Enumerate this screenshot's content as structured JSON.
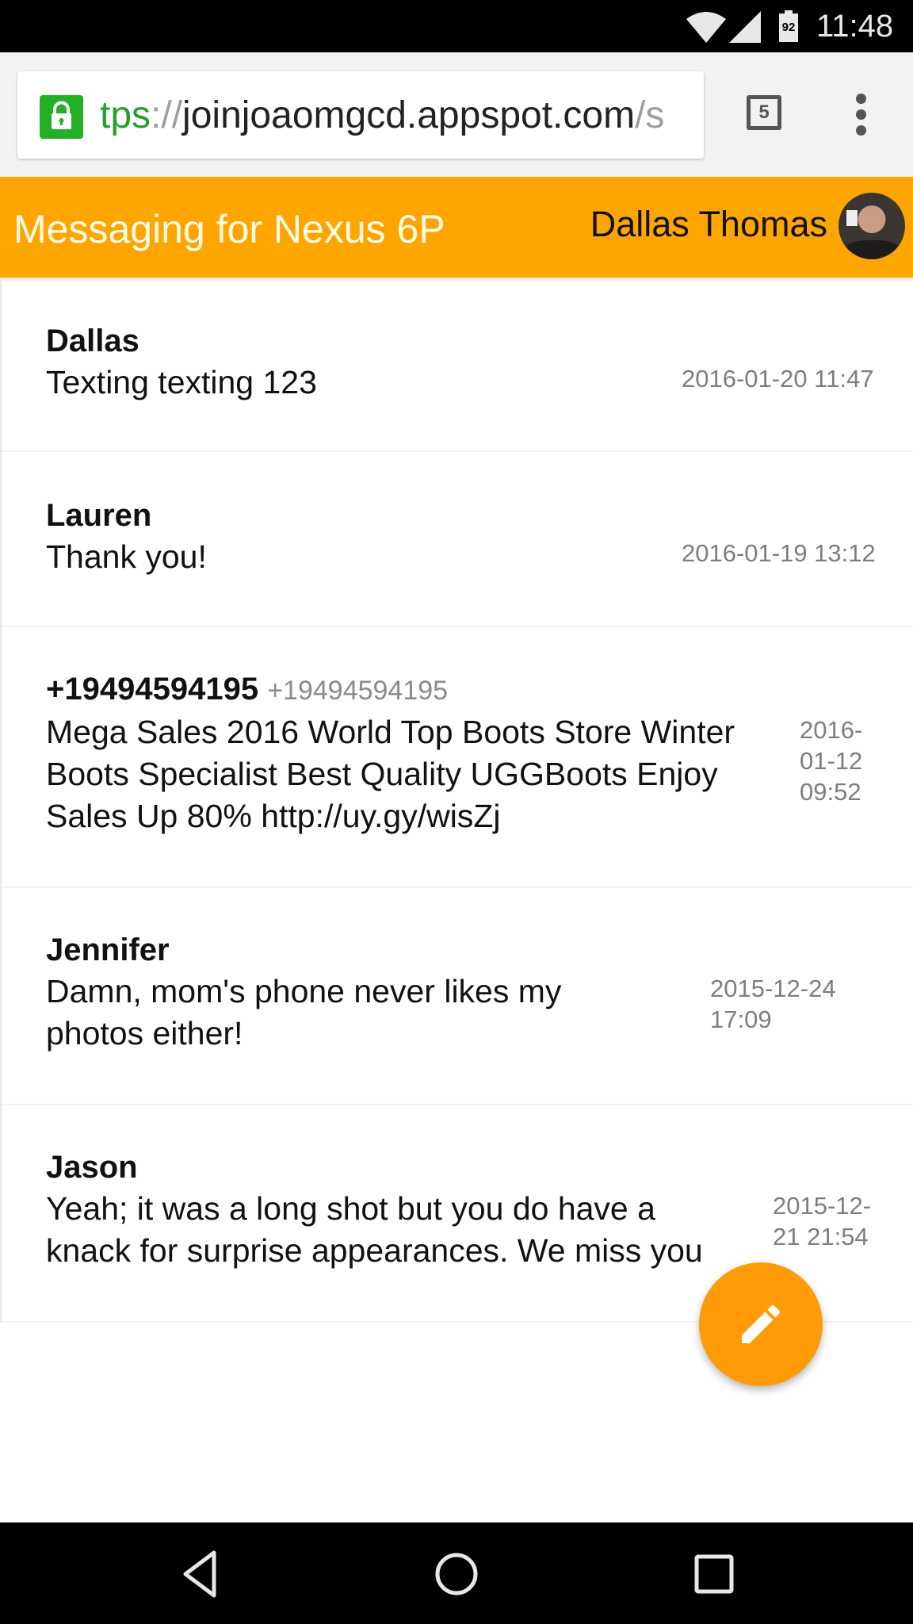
{
  "status_bar": {
    "battery_level": "92",
    "time": "11:48",
    "icons": [
      "wifi-icon",
      "cell-signal-icon",
      "battery-icon"
    ]
  },
  "browser": {
    "url_scheme": "tps",
    "url_separator": "://",
    "url_host": "joinjoaomgcd.appspot.com",
    "url_path": "/s",
    "tab_count": "5",
    "icons": [
      "lock-icon",
      "tab-switcher-icon",
      "more-vert-icon"
    ]
  },
  "header": {
    "title": "Messaging for Nexus 6P",
    "user_name": "Dallas Thomas",
    "accent_color": "#ffa500"
  },
  "conversations": [
    {
      "sender": "Dallas",
      "number": "",
      "message": "Texting texting 123",
      "timestamp": "2016-01-20 11:47"
    },
    {
      "sender": "Lauren",
      "number": "",
      "message": "Thank you!",
      "timestamp": "2016-01-19 13:12"
    },
    {
      "sender": "+19494594195",
      "number": "+19494594195",
      "message": "Mega Sales 2016 World Top Boots Store Winter\nBoots Specialist Best Quality UGGBoots Enjoy\nSales Up 80% http://uy.gy/wisZj",
      "timestamp": "2016-\n01-12\n09:52"
    },
    {
      "sender": "Jennifer",
      "number": "",
      "message": "Damn, mom's phone never likes my\nphotos either!",
      "timestamp": "2015-12-24\n17:09"
    },
    {
      "sender": "Jason",
      "number": "",
      "message": "Yeah; it was a long shot but you do have a\nknack for surprise appearances. We miss you",
      "timestamp": "2015-12-\n21 21:54"
    }
  ],
  "fab": {
    "icon": "pencil-icon",
    "action": "compose",
    "color": "#ff9b06"
  },
  "nav_bar": {
    "icons": [
      "back-icon",
      "home-icon",
      "recents-icon"
    ]
  }
}
